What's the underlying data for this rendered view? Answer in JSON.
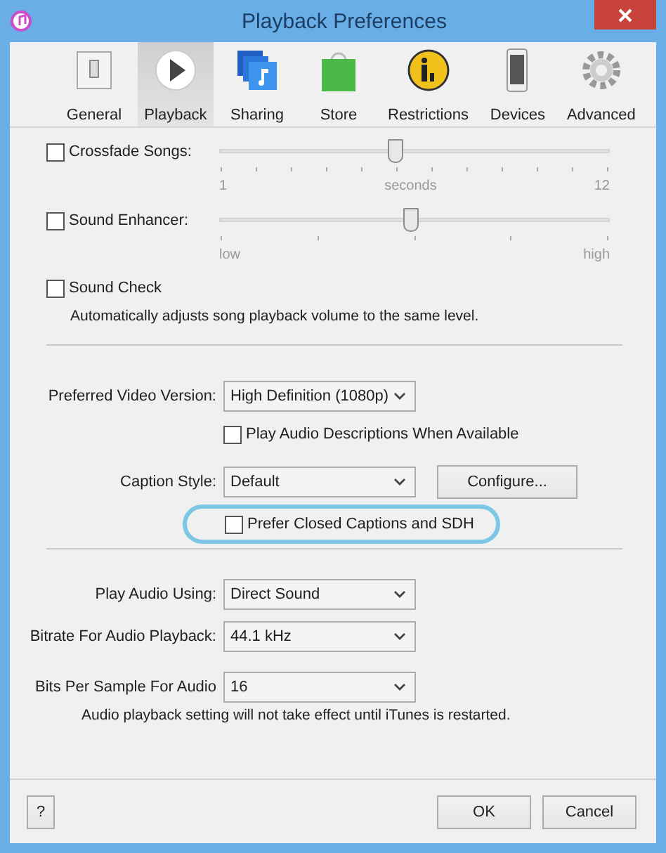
{
  "window": {
    "title": "Playback Preferences"
  },
  "tabs": [
    {
      "kind": "general",
      "label": "General",
      "selected": false
    },
    {
      "kind": "playback",
      "label": "Playback",
      "selected": true
    },
    {
      "kind": "sharing",
      "label": "Sharing",
      "selected": false
    },
    {
      "kind": "store",
      "label": "Store",
      "selected": false
    },
    {
      "kind": "restrictions",
      "label": "Restrictions",
      "selected": false
    },
    {
      "kind": "devices",
      "label": "Devices",
      "selected": false
    },
    {
      "kind": "advanced",
      "label": "Advanced",
      "selected": false
    }
  ],
  "sliders": [
    {
      "label": "Crossfade Songs:",
      "checked": false,
      "level": 0.45,
      "scale": [
        "1",
        "seconds",
        "12"
      ]
    },
    {
      "label": "Sound Enhancer:",
      "checked": false,
      "level": 0.49,
      "scale": [
        "low",
        "high"
      ]
    }
  ],
  "sound_check": {
    "label": "Sound Check",
    "checked": false,
    "note": "Automatically adjusts song playback volume to the same level."
  },
  "video": {
    "label": "Preferred Video Version:",
    "value": "High Definition (1080p)"
  },
  "audio_descriptions": {
    "label": "Play Audio Descriptions When Available",
    "checked": false
  },
  "caption": {
    "label": "Caption Style:",
    "value": "Default",
    "button": "Configure..."
  },
  "closed_captions": {
    "label": "Prefer Closed Captions and SDH",
    "checked": false,
    "highlighted": true
  },
  "audio_settings": [
    {
      "label": "Play Audio Using:",
      "value": "Direct Sound"
    },
    {
      "label": "Bitrate For Audio Playback:",
      "value": "44.1 kHz"
    },
    {
      "label": "Bits Per Sample For Audio",
      "value": "16"
    }
  ],
  "audio_note": "Audio playback setting will not take effect until iTunes is restarted.",
  "buttons": {
    "help": "?",
    "ok": "OK",
    "cancel": "Cancel"
  }
}
